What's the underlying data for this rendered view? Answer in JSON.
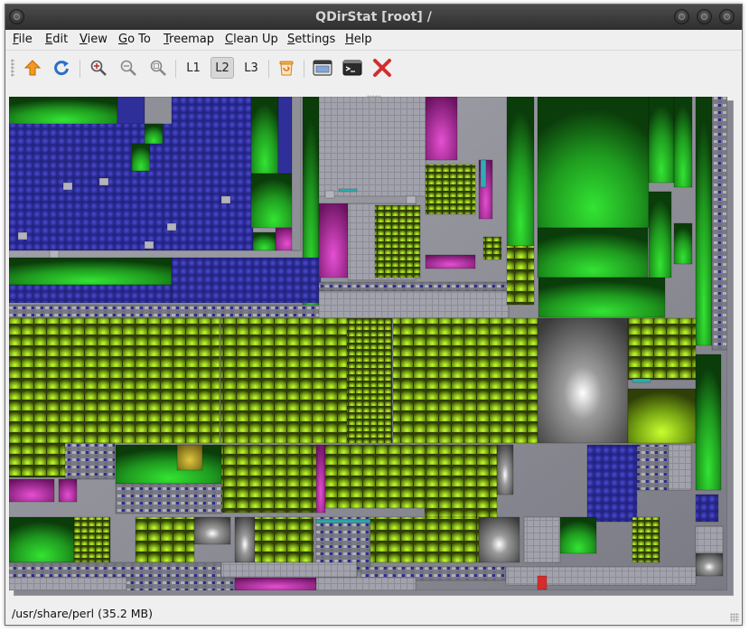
{
  "window": {
    "title": "QDirStat [root] /"
  },
  "menubar": {
    "items": [
      {
        "key": "file",
        "label": "File",
        "mnemonic": "F",
        "rest": "ile"
      },
      {
        "key": "edit",
        "label": "Edit",
        "mnemonic": "E",
        "rest": "dit"
      },
      {
        "key": "view",
        "label": "View",
        "mnemonic": "V",
        "rest": "iew"
      },
      {
        "key": "goto",
        "label": "Go To",
        "mnemonic": "G",
        "rest": "o To"
      },
      {
        "key": "treemap",
        "label": "Treemap",
        "mnemonic": "T",
        "rest": "reemap"
      },
      {
        "key": "cleanup",
        "label": "Clean Up",
        "mnemonic": "C",
        "rest": "lean Up"
      },
      {
        "key": "settings",
        "label": "Settings",
        "mnemonic": "S",
        "rest": "ettings"
      },
      {
        "key": "help",
        "label": "Help",
        "mnemonic": "H",
        "rest": "elp"
      }
    ]
  },
  "toolbar": {
    "level_buttons": [
      "L1",
      "L2",
      "L3"
    ],
    "pressed_level": "L2",
    "icons": [
      "go-up-icon",
      "refresh-icon",
      "zoom-in-icon",
      "zoom-out-icon",
      "zoom-reset-icon",
      "trash-icon",
      "file-manager-icon",
      "terminal-icon",
      "close-icon"
    ]
  },
  "status": {
    "text": "/usr/share/perl  (35.2 MB)"
  },
  "colors": {
    "accent_orange": "#f39a1e",
    "refresh_blue": "#2a6fc7",
    "delete_red": "#d32d2d",
    "treemap_green": "#3aa53a",
    "treemap_blue": "#2a2a9a",
    "treemap_lime": "#a6d81e",
    "treemap_magenta": "#c22fa6",
    "treemap_gray": "#9a9aa4"
  }
}
